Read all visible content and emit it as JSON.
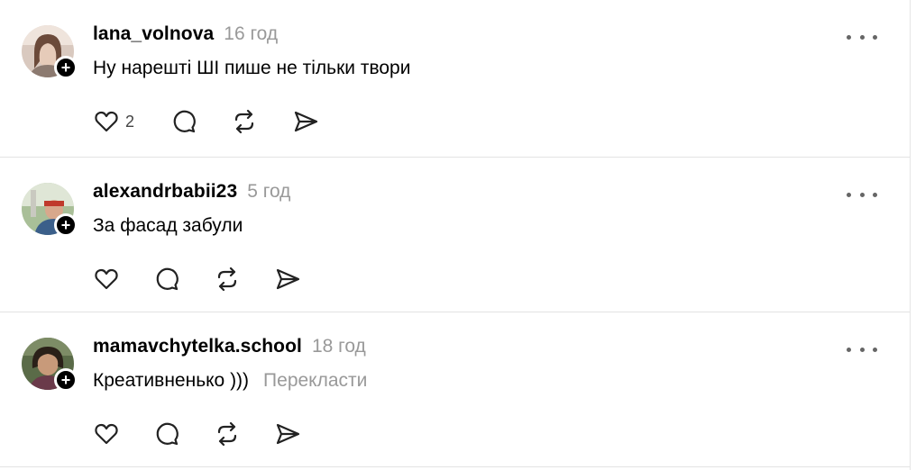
{
  "posts": [
    {
      "username": "lana_volnova",
      "time": "16 год",
      "text": "Ну нарешті ШІ пише не тільки твори",
      "translate": "",
      "likes": "2",
      "avatar_colors": [
        "#c9b3a6",
        "#e9d6cb",
        "#6b4a3a"
      ]
    },
    {
      "username": "alexandrbabii23",
      "time": "5 год",
      "text": "За фасад забули",
      "translate": "",
      "likes": "",
      "avatar_colors": [
        "#9ab38a",
        "#d8e0cf",
        "#c0392b"
      ]
    },
    {
      "username": "mamavchytelka.school",
      "time": "18 год",
      "text": "Креативненько )))",
      "translate": "Перекласти",
      "likes": "",
      "avatar_colors": [
        "#4a5a3a",
        "#b08a6a",
        "#2a2018"
      ]
    }
  ],
  "icons": {
    "like": "heart-icon",
    "reply": "comment-icon",
    "repost": "repost-icon",
    "share": "send-icon",
    "more": "more-dots-icon",
    "follow": "plus-icon"
  }
}
